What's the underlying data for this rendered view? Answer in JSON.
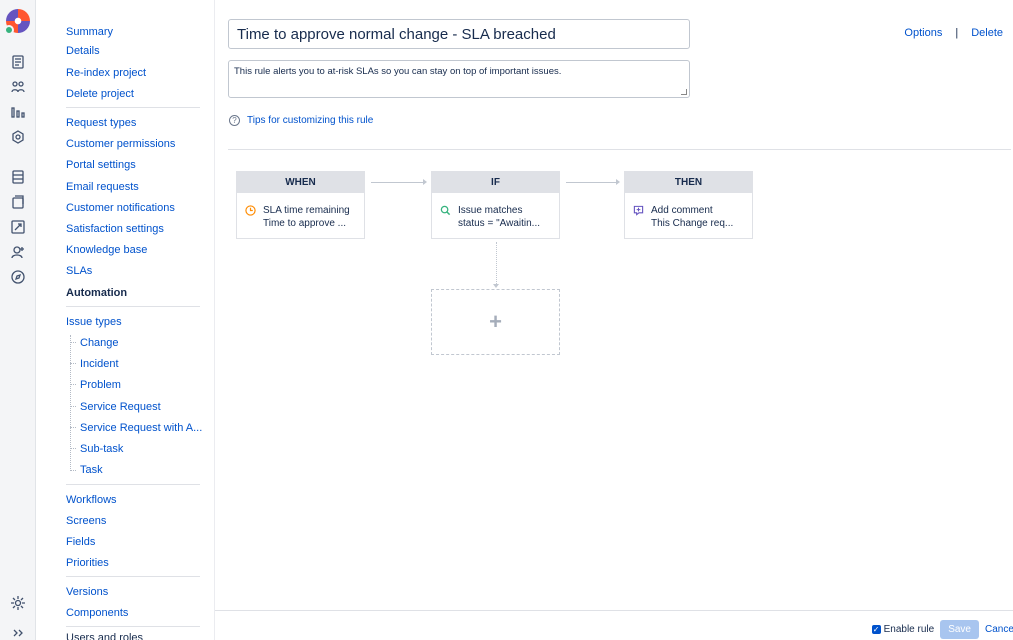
{
  "rail": {
    "icons": [
      "logo-icon",
      "queues-icon",
      "customers-icon",
      "reports-icon",
      "raise-request-icon",
      "knowledge-base-icon",
      "issues-icon",
      "add-item-icon",
      "invite-team-icon",
      "explore-icon"
    ],
    "bottom_icons": [
      "settings-icon",
      "expand-icon"
    ]
  },
  "sidebar": {
    "group1": [
      "Summary",
      "Details",
      "Re-index project",
      "Delete project"
    ],
    "group2": [
      "Request types",
      "Customer permissions",
      "Portal settings",
      "Email requests",
      "Customer notifications",
      "Satisfaction settings",
      "Knowledge base",
      "SLAs",
      "Automation"
    ],
    "issue_types_label": "Issue types",
    "issue_types": [
      "Change",
      "Incident",
      "Problem",
      "Service Request",
      "Service Request with A...",
      "Sub-task",
      "Task"
    ],
    "group4": [
      "Workflows",
      "Screens",
      "Fields",
      "Priorities"
    ],
    "group5": [
      "Versions",
      "Components",
      "Users and roles"
    ],
    "active": "Automation"
  },
  "rule": {
    "title": "Time to approve normal change - SLA breached",
    "description": "This rule alerts you to at-risk SLAs so you can stay on top of important issues.",
    "tips_label": "Tips for customizing this rule",
    "options_label": "Options",
    "separator": "|",
    "delete_label": "Delete"
  },
  "canvas": {
    "when": {
      "header": "WHEN",
      "line1": "SLA time remaining",
      "line2": "Time to approve ..."
    },
    "if": {
      "header": "IF",
      "line1": "Issue matches",
      "line2": "status = \"Awaitin..."
    },
    "then": {
      "header": "THEN",
      "line1": "Add comment",
      "line2": "This Change req..."
    },
    "add_symbol": "+"
  },
  "footer": {
    "enable_label": "Enable rule",
    "enable_checked": true,
    "save_label": "Save",
    "cancel_label": "Cancel"
  },
  "colors": {
    "link": "#0052cc",
    "node_header": "#dfe1e6",
    "clock": "#ff8b00",
    "search": "#36b37e",
    "comment": "#6554c0"
  }
}
